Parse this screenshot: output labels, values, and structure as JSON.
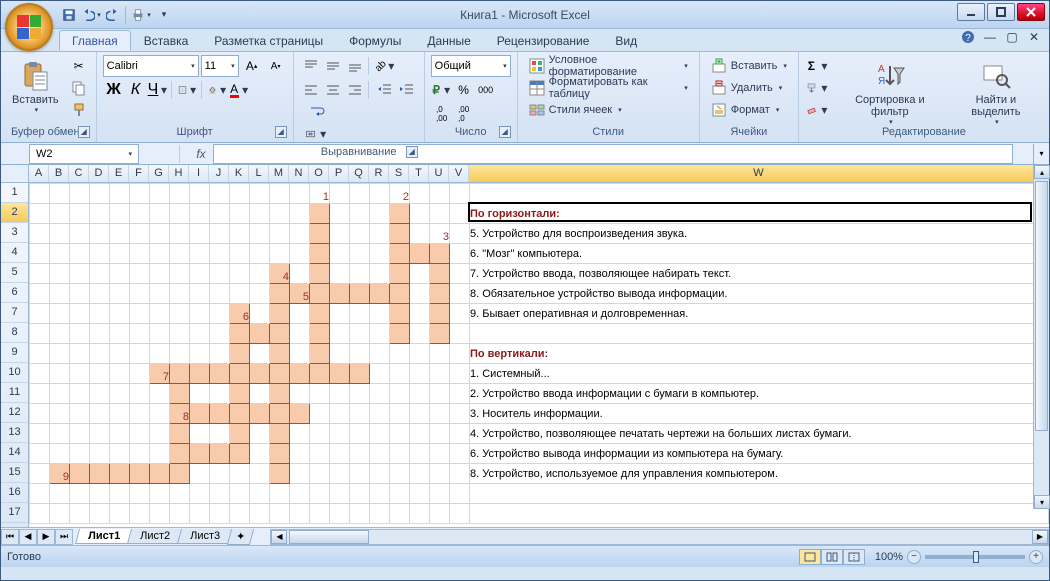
{
  "title": "Книга1 - Microsoft Excel",
  "qat": {
    "save": "save-icon",
    "undo": "undo-icon",
    "redo": "redo-icon",
    "print": "print-icon"
  },
  "tabs": [
    "Главная",
    "Вставка",
    "Разметка страницы",
    "Формулы",
    "Данные",
    "Рецензирование",
    "Вид"
  ],
  "active_tab": 0,
  "ribbon": {
    "clipboard": {
      "label": "Буфер обмена",
      "paste": "Вставить"
    },
    "font": {
      "label": "Шрифт",
      "name": "Calibri",
      "size": "11",
      "bold": "Ж",
      "italic": "К",
      "underline": "Ч"
    },
    "align": {
      "label": "Выравнивание"
    },
    "number": {
      "label": "Число",
      "format": "Общий"
    },
    "styles": {
      "label": "Стили",
      "cond": "Условное форматирование",
      "table": "Форматировать как таблицу",
      "cell": "Стили ячеек"
    },
    "cells": {
      "label": "Ячейки",
      "ins": "Вставить",
      "del": "Удалить",
      "fmt": "Формат"
    },
    "editing": {
      "label": "Редактирование",
      "sort": "Сортировка и фильтр",
      "find": "Найти и выделить"
    }
  },
  "formula_bar": {
    "name_box": "W2",
    "fx": "fx",
    "value": ""
  },
  "columns": [
    "A",
    "B",
    "C",
    "D",
    "E",
    "F",
    "G",
    "H",
    "I",
    "J",
    "K",
    "L",
    "M",
    "N",
    "O",
    "P",
    "Q",
    "R",
    "S",
    "T",
    "U",
    "V",
    "W"
  ],
  "row_count": 17,
  "active_cell": {
    "row": 2,
    "col": "W"
  },
  "crossword": {
    "numbers": [
      {
        "r": 1,
        "c": "O",
        "v": "1"
      },
      {
        "r": 1,
        "c": "S",
        "v": "2"
      },
      {
        "r": 3,
        "c": "U",
        "v": "3"
      },
      {
        "r": 5,
        "c": "M",
        "v": "4"
      },
      {
        "r": 6,
        "c": "N",
        "v": "5"
      },
      {
        "r": 7,
        "c": "K",
        "v": "6"
      },
      {
        "r": 10,
        "c": "G",
        "v": "7"
      },
      {
        "r": 12,
        "c": "H",
        "v": "8"
      },
      {
        "r": 15,
        "c": "B",
        "v": "9"
      }
    ],
    "cells": [
      [
        2,
        "O"
      ],
      [
        2,
        "S"
      ],
      [
        3,
        "O"
      ],
      [
        3,
        "S"
      ],
      [
        4,
        "O"
      ],
      [
        4,
        "S"
      ],
      [
        4,
        "T"
      ],
      [
        4,
        "U"
      ],
      [
        5,
        "M"
      ],
      [
        5,
        "O"
      ],
      [
        5,
        "S"
      ],
      [
        5,
        "U"
      ],
      [
        6,
        "M"
      ],
      [
        6,
        "N"
      ],
      [
        6,
        "O"
      ],
      [
        6,
        "P"
      ],
      [
        6,
        "Q"
      ],
      [
        6,
        "R"
      ],
      [
        6,
        "S"
      ],
      [
        6,
        "U"
      ],
      [
        7,
        "K"
      ],
      [
        7,
        "M"
      ],
      [
        7,
        "O"
      ],
      [
        7,
        "S"
      ],
      [
        7,
        "U"
      ],
      [
        8,
        "K"
      ],
      [
        8,
        "L"
      ],
      [
        8,
        "M"
      ],
      [
        8,
        "O"
      ],
      [
        8,
        "S"
      ],
      [
        8,
        "U"
      ],
      [
        9,
        "K"
      ],
      [
        9,
        "M"
      ],
      [
        9,
        "O"
      ],
      [
        10,
        "G"
      ],
      [
        10,
        "H"
      ],
      [
        10,
        "I"
      ],
      [
        10,
        "J"
      ],
      [
        10,
        "K"
      ],
      [
        10,
        "L"
      ],
      [
        10,
        "M"
      ],
      [
        10,
        "N"
      ],
      [
        10,
        "O"
      ],
      [
        10,
        "P"
      ],
      [
        10,
        "Q"
      ],
      [
        11,
        "H"
      ],
      [
        11,
        "K"
      ],
      [
        11,
        "M"
      ],
      [
        12,
        "H"
      ],
      [
        12,
        "I"
      ],
      [
        12,
        "J"
      ],
      [
        12,
        "K"
      ],
      [
        12,
        "L"
      ],
      [
        12,
        "M"
      ],
      [
        12,
        "N"
      ],
      [
        13,
        "H"
      ],
      [
        13,
        "K"
      ],
      [
        13,
        "M"
      ],
      [
        14,
        "H"
      ],
      [
        14,
        "I"
      ],
      [
        14,
        "J"
      ],
      [
        14,
        "K"
      ],
      [
        14,
        "M"
      ],
      [
        15,
        "B"
      ],
      [
        15,
        "C"
      ],
      [
        15,
        "D"
      ],
      [
        15,
        "E"
      ],
      [
        15,
        "F"
      ],
      [
        15,
        "G"
      ],
      [
        15,
        "H"
      ],
      [
        15,
        "M"
      ]
    ]
  },
  "clues": {
    "h_title": "По горизонтали:",
    "h": [
      "5. Устройство для воспроизведения звука.",
      "6. \"Мозг\" компьютера.",
      "7. Устройство ввода, позволяющее набирать текст.",
      "8. Обязательное устройство вывода информации.",
      "9. Бывает оперативная и долговременная."
    ],
    "v_title": "По вертикали:",
    "v": [
      "1. Системный...",
      "2. Устройство ввода информации с бумаги в компьютер.",
      "3. Носитель информации.",
      "4. Устройство, позволяющее печатать чертежи на больших листах бумаги.",
      "6. Устройство вывода информации из компьютера на бумагу.",
      "8. Устройство, используемое для управления компьютером."
    ]
  },
  "sheet_tabs": [
    "Лист1",
    "Лист2",
    "Лист3"
  ],
  "active_sheet": 0,
  "status": {
    "ready": "Готово",
    "zoom": "100%"
  }
}
